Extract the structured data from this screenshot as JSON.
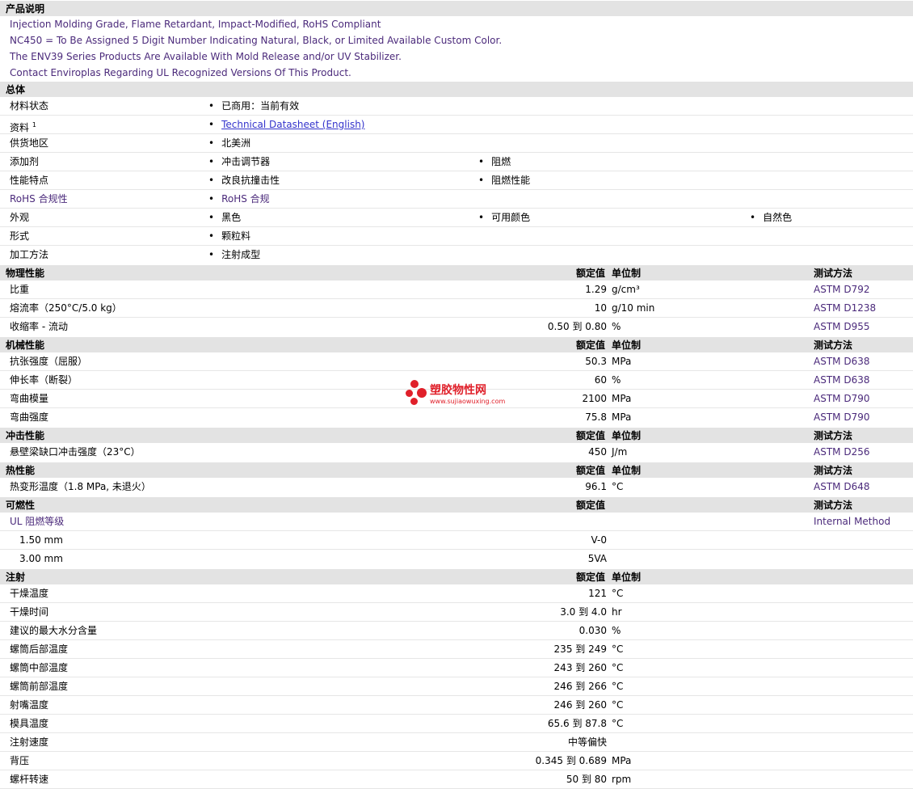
{
  "sections": {
    "desc_title": "产品说明",
    "desc_lines": [
      "Injection Molding Grade, Flame Retardant, Impact-Modified, RoHS Compliant",
      "NC450 = To Be Assigned 5 Digit Number Indicating Natural, Black, or Limited Available Custom Color.",
      "The ENV39 Series Products Are Available With Mold Release and/or UV Stabilizer.",
      "Contact Enviroplas Regarding UL Recognized Versions Of This Product."
    ],
    "general_title": "总体",
    "general": [
      {
        "label": "材料状态",
        "items": [
          "已商用：当前有效"
        ]
      },
      {
        "label": "资料",
        "sup": "1",
        "items": [
          "Technical Datasheet (English)"
        ]
      },
      {
        "label": "供货地区",
        "items": [
          "北美洲"
        ]
      },
      {
        "label": "添加剂",
        "items": [
          "冲击调节器",
          "阻燃"
        ]
      },
      {
        "label": "性能特点",
        "items": [
          "改良抗撞击性",
          "阻燃性能"
        ]
      },
      {
        "label": "RoHS 合规性",
        "items": [
          "RoHS 合规"
        ]
      },
      {
        "label": "外观",
        "items": [
          "黑色",
          "可用颜色",
          "自然色"
        ]
      },
      {
        "label": "形式",
        "items": [
          "颗粒料"
        ]
      },
      {
        "label": "加工方法",
        "items": [
          "注射成型"
        ]
      }
    ],
    "headers": {
      "nominal": "额定值",
      "unit": "单位制",
      "method": "测试方法"
    },
    "physical_title": "物理性能",
    "physical": [
      {
        "label": "比重",
        "value": "1.29",
        "unit": "g/cm³",
        "method": "ASTM D792"
      },
      {
        "label": "熔流率（250°C/5.0 kg）",
        "value": "10",
        "unit": "g/10 min",
        "method": "ASTM D1238"
      },
      {
        "label": "收缩率 - 流动",
        "value": "0.50 到  0.80",
        "unit": "%",
        "method": "ASTM D955"
      }
    ],
    "mechanical_title": "机械性能",
    "mechanical": [
      {
        "label": "抗张强度（屈服）",
        "value": "50.3",
        "unit": "MPa",
        "method": "ASTM D638"
      },
      {
        "label": "伸长率（断裂）",
        "value": "60",
        "unit": "%",
        "method": "ASTM D638"
      },
      {
        "label": "弯曲模量",
        "value": "2100",
        "unit": "MPa",
        "method": "ASTM D790"
      },
      {
        "label": "弯曲强度",
        "value": "75.8",
        "unit": "MPa",
        "method": "ASTM D790"
      }
    ],
    "impact_title": "冲击性能",
    "impact": [
      {
        "label": "悬壁梁缺口冲击强度（23°C）",
        "value": "450",
        "unit": "J/m",
        "method": "ASTM D256"
      }
    ],
    "thermal_title": "热性能",
    "thermal": [
      {
        "label": "热变形温度（1.8 MPa, 未退火）",
        "value": "96.1",
        "unit": "°C",
        "method": "ASTM D648"
      }
    ],
    "flammability_title": "可燃性",
    "flammability_label": "UL 阻燃等级",
    "flammability_method": "Internal Method",
    "flammability": [
      {
        "label": "1.50 mm",
        "value": "V-0"
      },
      {
        "label": "3.00 mm",
        "value": "5VA"
      }
    ],
    "injection_title": "注射",
    "injection": [
      {
        "label": "干燥温度",
        "value": "121",
        "unit": "°C"
      },
      {
        "label": "干燥时间",
        "value": "3.0 到  4.0",
        "unit": "hr"
      },
      {
        "label": "建议的最大水分含量",
        "value": "0.030",
        "unit": "%"
      },
      {
        "label": "螺筒后部温度",
        "value": "235 到  249",
        "unit": "°C"
      },
      {
        "label": "螺筒中部温度",
        "value": "243 到  260",
        "unit": "°C"
      },
      {
        "label": "螺筒前部温度",
        "value": "246 到  266",
        "unit": "°C"
      },
      {
        "label": "射嘴温度",
        "value": "246 到  260",
        "unit": "°C"
      },
      {
        "label": "模具温度",
        "value": "65.6 到  87.8",
        "unit": "°C"
      },
      {
        "label": "注射速度",
        "value": "中等偏快",
        "unit": ""
      },
      {
        "label": "背压",
        "value": "0.345 到  0.689",
        "unit": "MPa"
      },
      {
        "label": "螺杆转速",
        "value": "50 到  80",
        "unit": "rpm"
      }
    ]
  },
  "watermark": {
    "title": "塑胶物性网",
    "url": "www.sujiaowuxing.com"
  }
}
